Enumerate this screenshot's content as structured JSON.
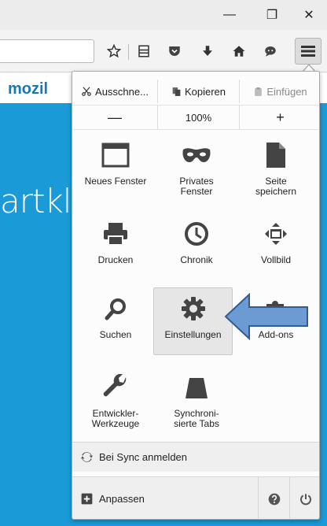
{
  "window": {
    "minimize_glyph": "—",
    "maximize_glyph": "❐",
    "close_glyph": "✕"
  },
  "toolbar": {
    "icons": [
      "star-icon",
      "bookmarks-icon",
      "pocket-icon",
      "download-icon",
      "home-icon",
      "chat-icon",
      "hamburger-menu-icon"
    ]
  },
  "page": {
    "brand": "mozil",
    "hero_text": "artkl"
  },
  "panel": {
    "edit": {
      "cut_label": "Ausschne...",
      "copy_label": "Kopieren",
      "paste_label": "Einfügen"
    },
    "zoom": {
      "minus": "—",
      "level": "100%",
      "plus": "+"
    },
    "items": {
      "new_window": "Neues Fenster",
      "private_window_1": "Privates",
      "private_window_2": "Fenster",
      "save_page_1": "Seite",
      "save_page_2": "speichern",
      "print": "Drucken",
      "history": "Chronik",
      "fullscreen": "Vollbild",
      "search": "Suchen",
      "settings": "Einstellungen",
      "addons": "Add-ons",
      "devtools_1": "Entwickler-",
      "devtools_2": "Werkzeuge",
      "synced_tabs_1": "Synchroni-",
      "synced_tabs_2": "sierte Tabs"
    },
    "sync_label": "Bei Sync anmelden",
    "customize_label": "Anpassen"
  },
  "colors": {
    "page_blue": "#1a9bd7",
    "callout_fill": "#6b9bd2",
    "callout_stroke": "#2f5d93"
  }
}
